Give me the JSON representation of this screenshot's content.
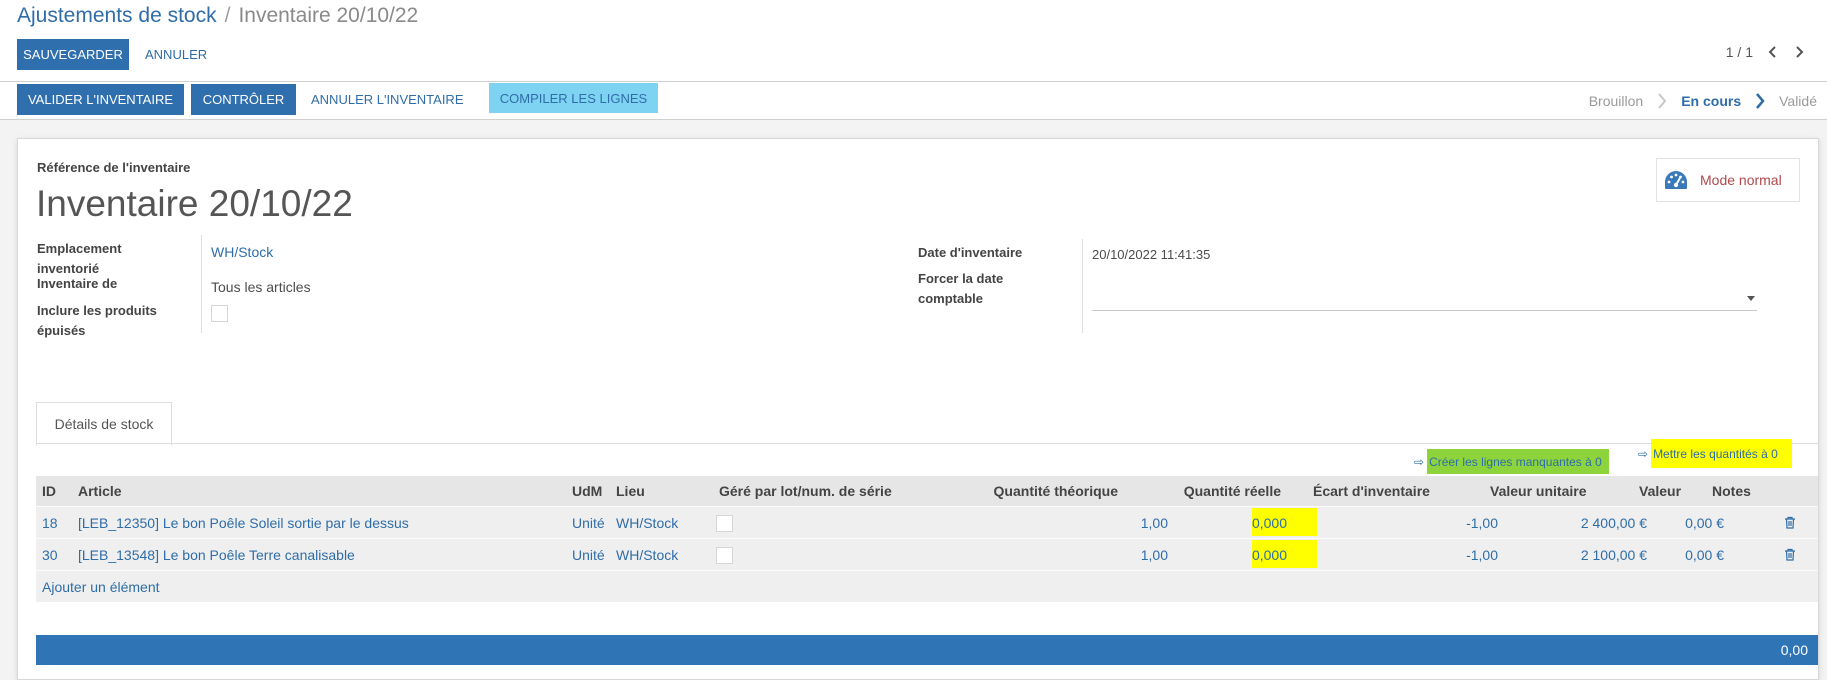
{
  "breadcrumb": {
    "parent": "Ajustements de stock",
    "separator": "/",
    "current": "Inventaire 20/10/22"
  },
  "toolbar": {
    "save_label": "SAUVEGARDER",
    "cancel_label": "ANNULER"
  },
  "pager": {
    "value": "1 / 1"
  },
  "actions": {
    "validate": "VALIDER L'INVENTAIRE",
    "control": "CONTRÔLER",
    "cancel_inventory": "ANNULER L'INVENTAIRE",
    "compile": "COMPILER LES LIGNES",
    "compile_highlight_color": "#7fd3f2"
  },
  "statusbar": {
    "steps": [
      "Brouillon",
      "En cours",
      "Validé"
    ],
    "active": "En cours"
  },
  "form": {
    "ref_label": "Référence de l'inventaire",
    "title": "Inventaire 20/10/22",
    "mode_button": "Mode normal",
    "location_label_1": "Emplacement",
    "location_label_2": "inventorié",
    "location_value": "WH/Stock",
    "products_label": "Inventaire de",
    "products_value": "Tous les articles",
    "exhausted_label_1": "Inclure les produits",
    "exhausted_label_2": "épuisés",
    "date_label": "Date d'inventaire",
    "date_value": "20/10/2022 11:41:35",
    "accounting_label_1": "Forcer la date",
    "accounting_label_2": "comptable",
    "accounting_value": ""
  },
  "tabs": {
    "stock_details": "Détails de stock"
  },
  "shortcuts": {
    "arrow": "⇨",
    "create_missing": "Créer les lignes manquantes à 0",
    "set_zero": "Mettre les quantités à 0",
    "create_missing_color": "#8dd43c",
    "set_zero_color": "#ffff00"
  },
  "table": {
    "headers": {
      "id": "ID",
      "article": "Article",
      "uom": "UdM",
      "location": "Lieu",
      "lot": "Géré par lot/num. de série",
      "theoretical": "Quantité théorique",
      "real": "Quantité réelle",
      "diff": "Écart d'inventaire",
      "unit_value": "Valeur unitaire",
      "value": "Valeur",
      "notes": "Notes"
    },
    "rows": [
      {
        "id": "18",
        "article": "[LEB_12350] Le bon Poêle Soleil sortie par le dessus",
        "uom": "Unité",
        "location": "WH/Stock",
        "theoretical": "1,00",
        "real": "0,000",
        "diff": "-1,00",
        "unit_value": "2 400,00 €",
        "value": "0,00 €"
      },
      {
        "id": "30",
        "article": "[LEB_13548] Le bon Poêle Terre canalisable",
        "uom": "Unité",
        "location": "WH/Stock",
        "theoretical": "1,00",
        "real": "0,000",
        "diff": "-1,00",
        "unit_value": "2 100,00 €",
        "value": "0,00 €"
      }
    ],
    "add_line": "Ajouter un élément",
    "real_highlight_color": "#ffff00",
    "total": "0,00"
  }
}
